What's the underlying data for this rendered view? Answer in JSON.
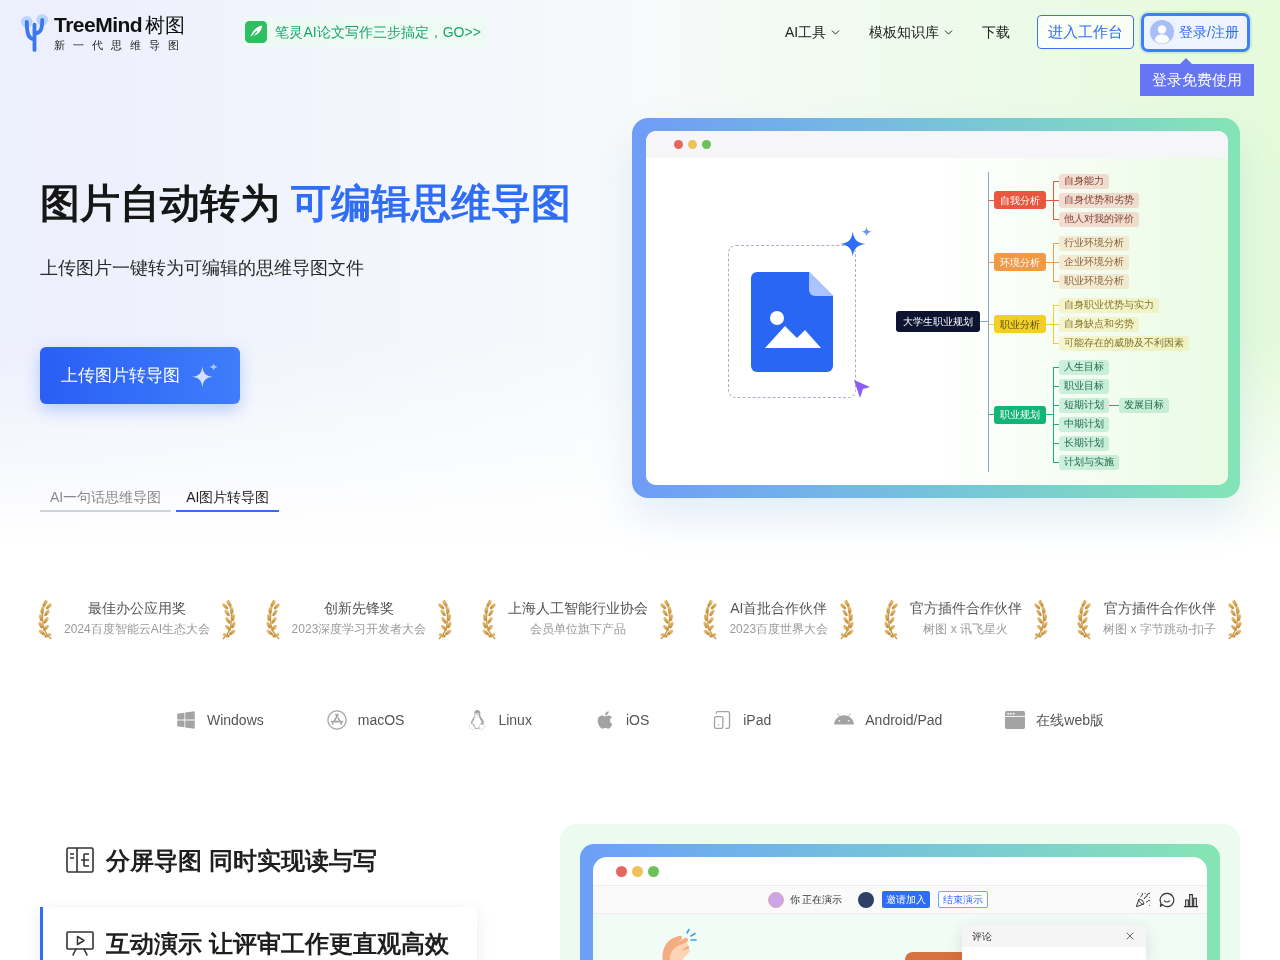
{
  "header": {
    "logo": {
      "name": "TreeMind",
      "name_cn": "树图",
      "tagline": "新一代思维导图"
    },
    "promo": "笔灵AI论文写作三步搞定，GO>>",
    "nav": [
      {
        "label": "AI工具",
        "kind": "dropdown"
      },
      {
        "label": "模板知识库",
        "kind": "dropdown"
      },
      {
        "label": "下载",
        "kind": "link"
      }
    ],
    "workspace_button": "进入工作台",
    "login_button": "登录/注册",
    "login_tooltip": "登录免费使用"
  },
  "hero": {
    "title": "图片自动转为",
    "title_highlight": "可编辑思维导图",
    "subtitle": "上传图片一键转为可编辑的思维导图文件",
    "upload_button": "上传图片转导图",
    "tabs": [
      {
        "label": "AI一句话思维导图",
        "selected": false
      },
      {
        "label": "AI图片转导图",
        "selected": true
      }
    ]
  },
  "preview": {
    "mindmap": {
      "root": "大学生职业规划",
      "branches": [
        {
          "label": "自我分析",
          "color": "#e9573f",
          "children": [
            {
              "label": "自身能力"
            },
            {
              "label": "自身优势和劣势"
            },
            {
              "label": "他人对我的评价"
            }
          ]
        },
        {
          "label": "环境分析",
          "color": "#f09a45",
          "children": [
            {
              "label": "行业环境分析"
            },
            {
              "label": "企业环境分析"
            },
            {
              "label": "职业环境分析"
            }
          ]
        },
        {
          "label": "职业分析",
          "color": "#f2cf24",
          "children": [
            {
              "label": "自身职业优势与实力"
            },
            {
              "label": "自身缺点和劣势"
            },
            {
              "label": "可能存在的威胁及不利因素"
            }
          ]
        },
        {
          "label": "职业规划",
          "color": "#14b477",
          "children": [
            {
              "label": "人生目标"
            },
            {
              "label": "职业目标"
            },
            {
              "label": "短期计划",
              "children": [
                {
                  "label": "发展目标"
                }
              ]
            },
            {
              "label": "中期计划"
            },
            {
              "label": "长期计划"
            },
            {
              "label": "计划与实施"
            }
          ]
        }
      ]
    }
  },
  "awards": [
    {
      "title": "最佳办公应用奖",
      "subtitle": "2024百度智能云AI生态大会"
    },
    {
      "title": "创新先锋奖",
      "subtitle": "2023深度学习开发者大会"
    },
    {
      "title": "上海人工智能行业协会",
      "subtitle": "会员单位旗下产品"
    },
    {
      "title": "AI首批合作伙伴",
      "subtitle": "2023百度世界大会"
    },
    {
      "title": "官方插件合作伙伴",
      "subtitle": "树图 x 讯飞星火"
    },
    {
      "title": "官方插件合作伙伴",
      "subtitle": "树图 x 字节跳动-扣子"
    }
  ],
  "platforms": [
    {
      "label": "Windows",
      "kind": "windows"
    },
    {
      "label": "macOS",
      "kind": "macos"
    },
    {
      "label": "Linux",
      "kind": "linux"
    },
    {
      "label": "iOS",
      "kind": "ios"
    },
    {
      "label": "iPad",
      "kind": "ipad"
    },
    {
      "label": "Android/Pad",
      "kind": "android"
    },
    {
      "label": "在线web版",
      "kind": "web"
    }
  ],
  "features": [
    {
      "title": "分屏导图 同时实现读与写",
      "kind": "split_screen",
      "selected": false
    },
    {
      "title": "互动演示 让评审工作更直观高效",
      "kind": "presentation",
      "selected": true
    }
  ],
  "demo": {
    "presenter_label": "你 正在演示",
    "invite_button": "邀请加入",
    "end_button": "结束演示",
    "comments_title": "评论"
  }
}
